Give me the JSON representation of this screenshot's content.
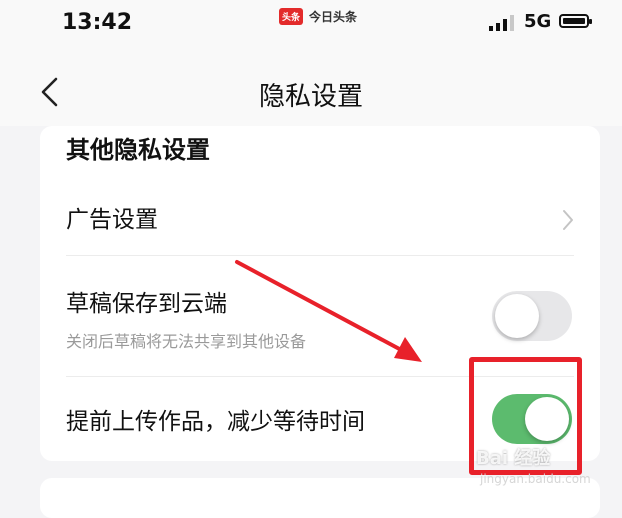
{
  "status_bar": {
    "time": "13:42",
    "app_logo": "头条",
    "app_name": "今日头条",
    "network": "5G",
    "icons": [
      "signal-icon",
      "battery-icon"
    ]
  },
  "nav": {
    "title": "隐私设置",
    "back_icon": "back-chevron-icon"
  },
  "settings": {
    "section_title": "其他隐私设置",
    "ad_settings_label": "广告设置",
    "draft_cloud_label": "草稿保存到云端",
    "draft_cloud_sub": "关闭后草稿将无法共享到其他设备",
    "draft_cloud_on": false,
    "pre_upload_label": "提前上传作品，减少等待时间",
    "pre_upload_on": true
  },
  "colors": {
    "toggle_on": "#5cbb6e",
    "toggle_off": "#e7e7e9",
    "annotation": "#e8212a"
  },
  "watermark": {
    "logo": "Bai 经验",
    "url": "jingyan.baidu.com"
  }
}
